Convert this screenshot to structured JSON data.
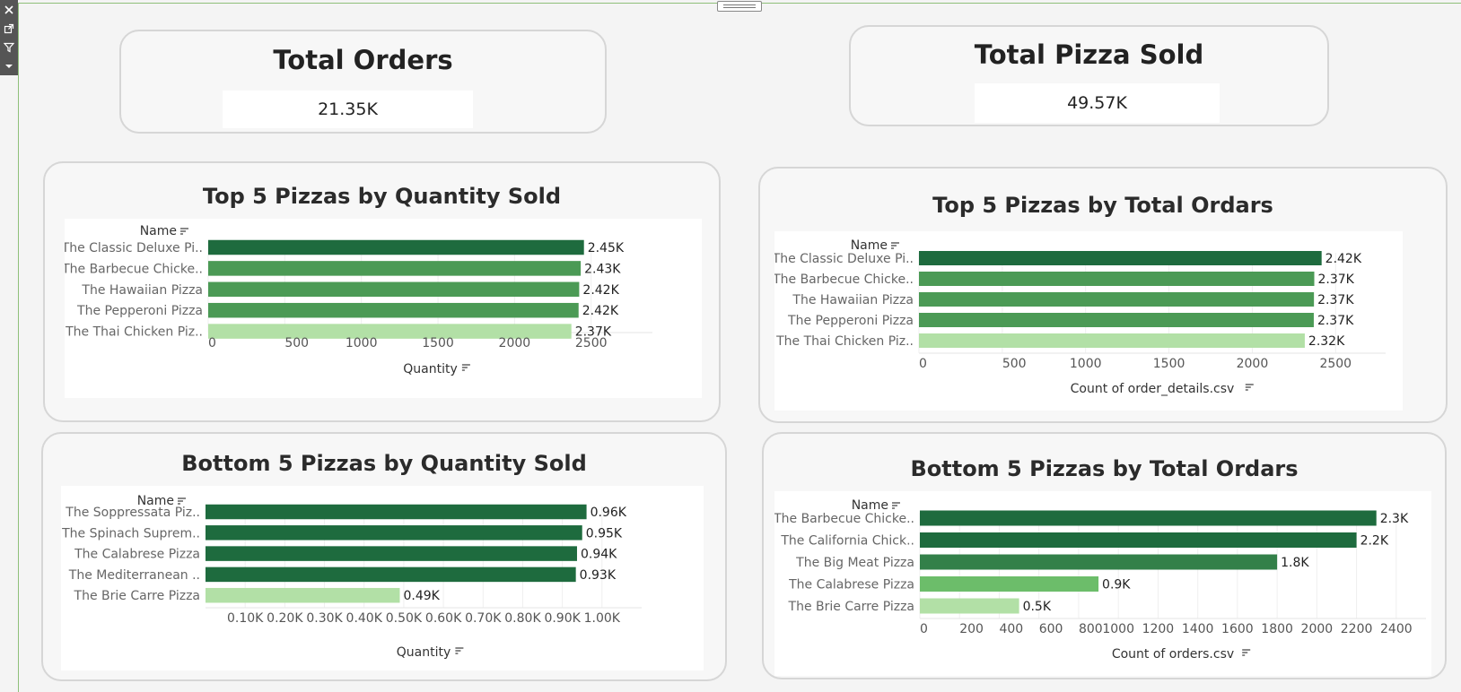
{
  "toolbar": {
    "items": [
      {
        "icon": "close-icon",
        "glyph": "✕"
      },
      {
        "icon": "popout-icon",
        "glyph": "⧉"
      },
      {
        "icon": "filter-icon",
        "glyph": "⊽"
      },
      {
        "icon": "dropdown-icon",
        "glyph": "▾"
      }
    ]
  },
  "kpis": {
    "total_orders": {
      "title": "Total Orders",
      "value": "21.35K"
    },
    "total_pizza_sold": {
      "title": "Total Pizza Sold",
      "value": "49.57K"
    }
  },
  "colors": {
    "dark": "#1e6b3e",
    "mid": "#4b9a55",
    "light": "#6cbd6a",
    "pale": "#b2e0a6"
  },
  "charts": [
    {
      "title": "Top 5 Pizzas by Quantity Sold",
      "chart_data": {
        "type": "bar",
        "orientation": "horizontal",
        "row_header": "Name",
        "categories": [
          "The Classic Deluxe Pi..",
          "The Barbecue Chicke..",
          "The Hawaiian Pizza",
          "The Pepperoni Pizza",
          "The Thai Chicken Piz.."
        ],
        "values": [
          2453,
          2432,
          2422,
          2418,
          2371
        ],
        "labels": [
          "2.45K",
          "2.43K",
          "2.42K",
          "2.42K",
          "2.37K"
        ],
        "bar_colors": [
          "#1e6b3e",
          "#4b9a55",
          "#4b9a55",
          "#4b9a55",
          "#b2e0a6"
        ],
        "xlabel": "Quantity",
        "xlim": [
          0,
          2900
        ],
        "ticks": [
          0,
          500,
          1000,
          1500,
          2000,
          2500
        ],
        "tick_labels": [
          "0",
          "500",
          "1000",
          "1500",
          "2000",
          "2500"
        ]
      }
    },
    {
      "title": "Top 5 Pizzas by  Total Ordars",
      "chart_data": {
        "type": "bar",
        "orientation": "horizontal",
        "row_header": "Name",
        "categories": [
          "The Classic Deluxe Pi..",
          "The Barbecue Chicke..",
          "The Hawaiian Pizza",
          "The Pepperoni Pizza",
          "The Thai Chicken Piz.."
        ],
        "values": [
          2416,
          2372,
          2370,
          2369,
          2315
        ],
        "labels": [
          "2.42K",
          "2.37K",
          "2.37K",
          "2.37K",
          "2.32K"
        ],
        "bar_colors": [
          "#1e6b3e",
          "#4b9a55",
          "#4b9a55",
          "#4b9a55",
          "#b2e0a6"
        ],
        "xlabel": "Count of order_details.csv",
        "xlim": [
          0,
          2800
        ],
        "ticks": [
          0,
          500,
          1000,
          1500,
          2000,
          2500
        ],
        "tick_labels": [
          "0",
          "500",
          "1000",
          "1500",
          "2000",
          "2500"
        ]
      }
    },
    {
      "title": "Bottom 5 Pizzas by Quantity Sold",
      "chart_data": {
        "type": "bar",
        "orientation": "horizontal",
        "row_header": "Name",
        "categories": [
          "The Soppressata Piz..",
          "The Spinach Suprem..",
          "The Calabrese Pizza",
          "The Mediterranean ..",
          "The Brie Carre Pizza"
        ],
        "values": [
          961,
          950,
          937,
          934,
          490
        ],
        "labels": [
          "0.96K",
          "0.95K",
          "0.94K",
          "0.93K",
          "0.49K"
        ],
        "bar_colors": [
          "#1e6b3e",
          "#1e6b3e",
          "#1e6b3e",
          "#1e6b3e",
          "#b2e0a6"
        ],
        "xlabel": "Quantity",
        "xlim": [
          0,
          1100
        ],
        "ticks": [
          100,
          200,
          300,
          400,
          500,
          600,
          700,
          800,
          900,
          1000
        ],
        "tick_labels": [
          "0.10K",
          "0.20K",
          "0.30K",
          "0.40K",
          "0.50K",
          "0.60K",
          "0.70K",
          "0.80K",
          "0.90K",
          "1.00K"
        ]
      }
    },
    {
      "title": "Bottom 5 Pizzas by  Total Ordars",
      "chart_data": {
        "type": "bar",
        "orientation": "horizontal",
        "row_header": "Name",
        "categories": [
          "The Barbecue Chicke..",
          "The California Chick..",
          "The Big Meat Pizza",
          "The Calabrese Pizza",
          "The Brie Carre Pizza"
        ],
        "values": [
          2300,
          2200,
          1800,
          900,
          500
        ],
        "labels": [
          "2.3K",
          "2.2K",
          "1.8K",
          "0.9K",
          "0.5K"
        ],
        "bar_colors": [
          "#1e6b3e",
          "#1e6b3e",
          "#338049",
          "#6cbd6a",
          "#b2e0a6"
        ],
        "xlabel": "Count of orders.csv",
        "xlim": [
          0,
          2550
        ],
        "ticks": [
          0,
          200,
          400,
          600,
          800,
          1000,
          1200,
          1400,
          1600,
          1800,
          2000,
          2200,
          2400
        ],
        "tick_labels": [
          "0",
          "200",
          "400",
          "600",
          "800",
          "1000",
          "1200",
          "1400",
          "1600",
          "1800",
          "2000",
          "2200",
          "2400"
        ]
      }
    }
  ]
}
